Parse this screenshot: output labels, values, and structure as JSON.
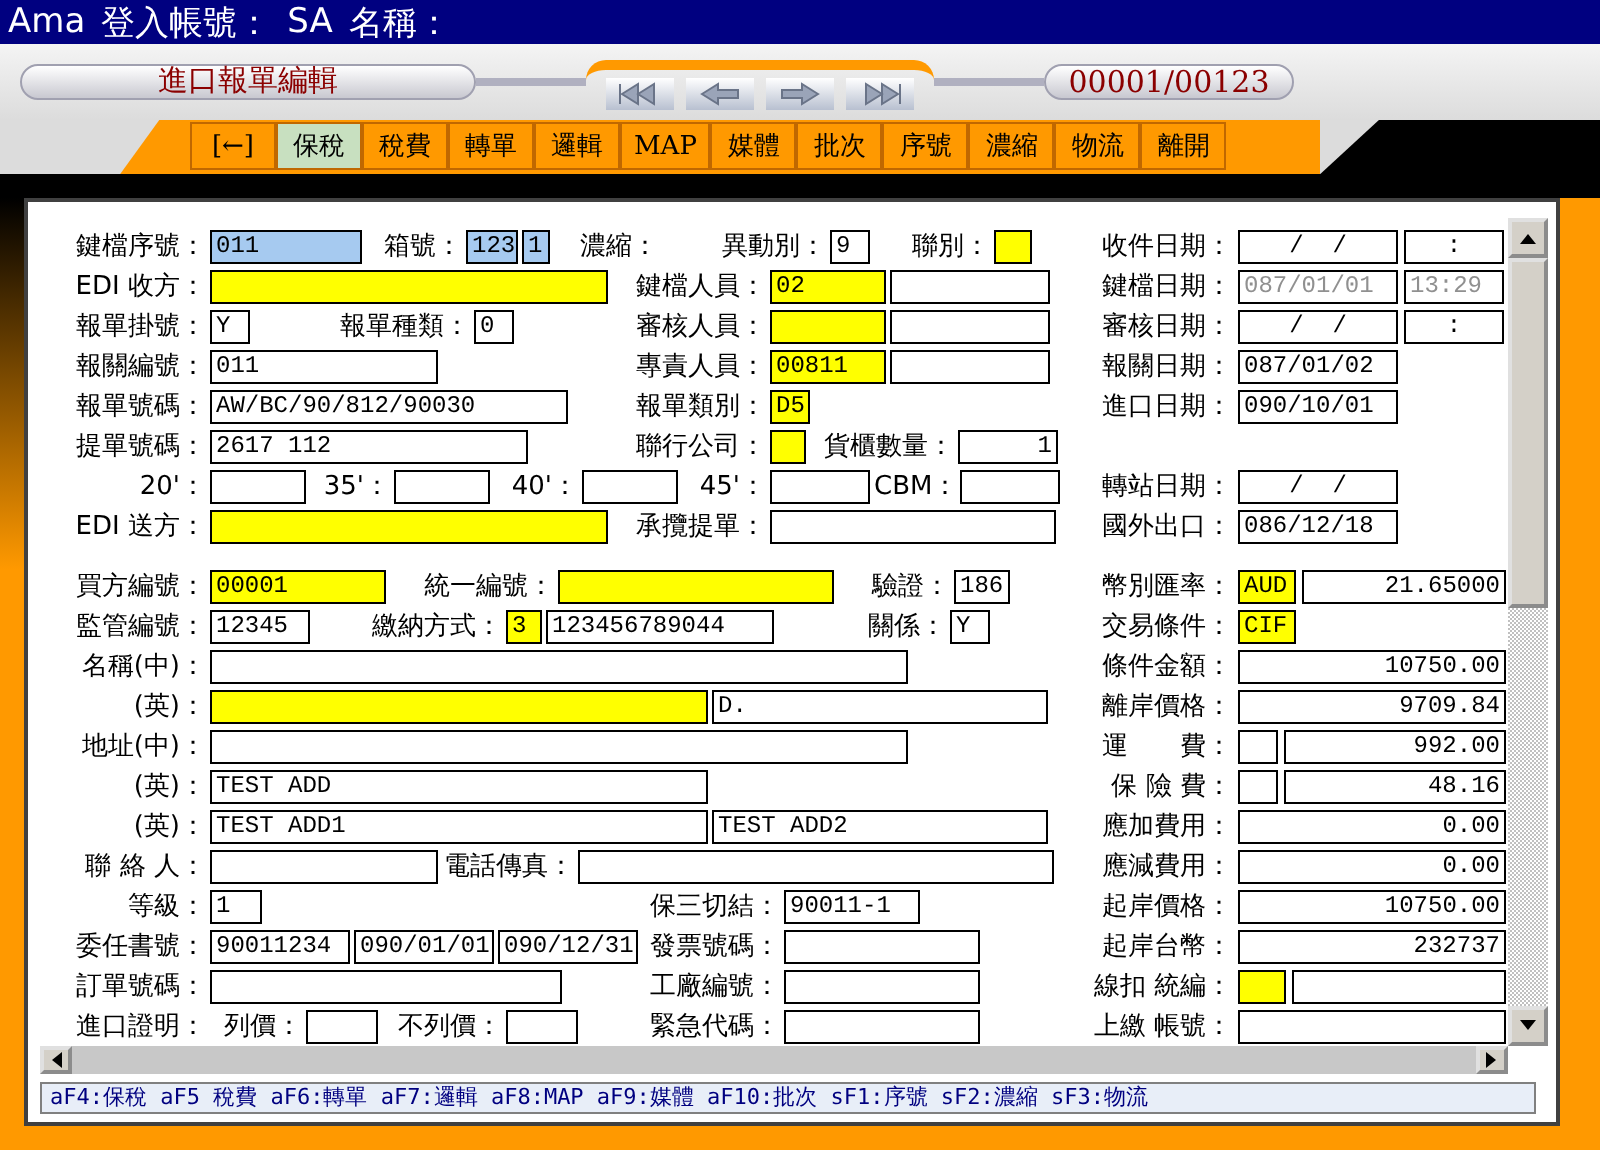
{
  "window": {
    "title": [
      "Ama",
      "登入帳號：",
      "SA",
      "名稱："
    ]
  },
  "header": {
    "screen_title": "進口報單編輯",
    "record_counter": "00001/00123"
  },
  "toolbar": [
    {
      "label": "[←]",
      "selected": false
    },
    {
      "label": "保稅",
      "selected": true
    },
    {
      "label": "稅費",
      "selected": false
    },
    {
      "label": "轉單",
      "selected": false
    },
    {
      "label": "邏輯",
      "selected": false
    },
    {
      "label": "MAP",
      "selected": false
    },
    {
      "label": "媒體",
      "selected": false
    },
    {
      "label": "批次",
      "selected": false
    },
    {
      "label": "序號",
      "selected": false
    },
    {
      "label": "濃縮",
      "selected": false
    },
    {
      "label": "物流",
      "selected": false
    },
    {
      "label": "離開",
      "selected": false
    }
  ],
  "sections": [
    {
      "rows": [
        {
          "left": [
            {
              "kind": "label",
              "text": "鍵檔序號："
            },
            {
              "kind": "field",
              "value": "011",
              "color": "#a6caf0"
            },
            {
              "kind": "label",
              "text": "箱號："
            },
            {
              "kind": "field",
              "value": "123",
              "color": "#a6caf0"
            },
            {
              "kind": "field",
              "value": "1",
              "color": "#a6caf0"
            },
            {
              "kind": "label",
              "text": "濃縮："
            },
            {
              "kind": "label",
              "text": "異動別："
            },
            {
              "kind": "field",
              "value": "9"
            },
            {
              "kind": "label",
              "text": "聯別："
            },
            {
              "kind": "field",
              "color": "#ffff00"
            }
          ],
          "right": [
            {
              "kind": "label",
              "text": "收件日期："
            },
            {
              "kind": "field",
              "value": "/  /",
              "center": true
            },
            {
              "kind": "field",
              "value": ":",
              "center": true
            }
          ]
        },
        {
          "left": [
            {
              "kind": "label",
              "text": "EDI 收方："
            },
            {
              "kind": "field",
              "color": "#ffff00"
            },
            {
              "kind": "label",
              "text": "鍵檔人員："
            },
            {
              "kind": "field",
              "value": "02",
              "color": "#ffff00"
            },
            {
              "kind": "field"
            }
          ],
          "right": [
            {
              "kind": "label",
              "text": "鍵檔日期："
            },
            {
              "kind": "field",
              "value": "087/01/01",
              "disabled": true
            },
            {
              "kind": "field",
              "value": "13:29",
              "disabled": true
            }
          ]
        },
        {
          "left": [
            {
              "kind": "label",
              "text": "報單掛號："
            },
            {
              "kind": "field",
              "value": "Y"
            },
            {
              "kind": "label",
              "text": "報單種類："
            },
            {
              "kind": "field",
              "value": "0"
            },
            {
              "kind": "label",
              "text": "審核人員："
            },
            {
              "kind": "field",
              "color": "#ffff00"
            },
            {
              "kind": "field"
            }
          ],
          "right": [
            {
              "kind": "label",
              "text": "審核日期："
            },
            {
              "kind": "field",
              "value": "/  /",
              "center": true
            },
            {
              "kind": "field",
              "value": ":",
              "center": true
            }
          ]
        },
        {
          "left": [
            {
              "kind": "label",
              "text": "報關編號："
            },
            {
              "kind": "field",
              "value": "011"
            },
            {
              "kind": "label",
              "text": "專責人員："
            },
            {
              "kind": "field",
              "value": "00811",
              "color": "#ffff00"
            },
            {
              "kind": "field"
            }
          ],
          "right": [
            {
              "kind": "label",
              "text": "報關日期："
            },
            {
              "kind": "field",
              "value": "087/01/02"
            }
          ]
        },
        {
          "left": [
            {
              "kind": "label",
              "text": "報單號碼："
            },
            {
              "kind": "field",
              "value": "AW/BC/90/812/90030"
            },
            {
              "kind": "label",
              "text": "報單類別："
            },
            {
              "kind": "field",
              "value": "D5",
              "color": "#ffff00"
            }
          ],
          "right": [
            {
              "kind": "label",
              "text": "進口日期："
            },
            {
              "kind": "field",
              "value": "090/10/01"
            }
          ]
        },
        {
          "left": [
            {
              "kind": "label",
              "text": "提單號碼："
            },
            {
              "kind": "field",
              "value": "2617 112"
            },
            {
              "kind": "label",
              "text": "聯行公司："
            },
            {
              "kind": "field",
              "color": "#ffff00"
            },
            {
              "kind": "label",
              "text": "貨櫃數量："
            },
            {
              "kind": "field",
              "value": "1",
              "numeric": true
            }
          ],
          "right": []
        },
        {
          "left": [
            {
              "kind": "label",
              "text": "20'："
            },
            {
              "kind": "field"
            },
            {
              "kind": "label",
              "text": "35'："
            },
            {
              "kind": "field"
            },
            {
              "kind": "label",
              "text": "40'："
            },
            {
              "kind": "field"
            },
            {
              "kind": "label",
              "text": "45'："
            },
            {
              "kind": "field"
            },
            {
              "kind": "label",
              "text": "CBM："
            },
            {
              "kind": "field"
            }
          ],
          "right": [
            {
              "kind": "label",
              "text": "轉站日期："
            },
            {
              "kind": "field",
              "value": "/  /",
              "center": true
            }
          ]
        },
        {
          "left": [
            {
              "kind": "label",
              "text": "EDI 送方："
            },
            {
              "kind": "field",
              "color": "#ffff00"
            },
            {
              "kind": "label",
              "text": "承攬提單："
            },
            {
              "kind": "field"
            }
          ],
          "right": [
            {
              "kind": "label",
              "text": "國外出口："
            },
            {
              "kind": "field",
              "value": "086/12/18"
            }
          ]
        }
      ]
    },
    {
      "rows": [
        {
          "left": [
            {
              "kind": "label",
              "text": "買方編號："
            },
            {
              "kind": "field",
              "value": "00001",
              "color": "#ffff00"
            },
            {
              "kind": "label",
              "text": "統一編號："
            },
            {
              "kind": "field",
              "color": "#ffff00"
            },
            {
              "kind": "label",
              "text": "驗證："
            },
            {
              "kind": "field",
              "value": "186"
            }
          ],
          "right": [
            {
              "kind": "label",
              "text": "幣別匯率："
            },
            {
              "kind": "field",
              "value": "AUD",
              "color": "#ffff00"
            },
            {
              "kind": "field",
              "value": "21.65000",
              "numeric": true
            }
          ]
        },
        {
          "left": [
            {
              "kind": "label",
              "text": "監管編號："
            },
            {
              "kind": "field",
              "value": "12345"
            },
            {
              "kind": "label",
              "text": "繳納方式："
            },
            {
              "kind": "field",
              "value": "3",
              "color": "#ffff00"
            },
            {
              "kind": "field",
              "value": "123456789044"
            },
            {
              "kind": "label",
              "text": "關係："
            },
            {
              "kind": "field",
              "value": "Y"
            }
          ],
          "right": [
            {
              "kind": "label",
              "text": "交易條件："
            },
            {
              "kind": "field",
              "value": "CIF",
              "color": "#ffff00"
            }
          ]
        },
        {
          "left": [
            {
              "kind": "label",
              "text": "名稱(中)："
            },
            {
              "kind": "field"
            }
          ],
          "right": [
            {
              "kind": "label",
              "text": "條件金額："
            },
            {
              "kind": "field",
              "value": "10750.00",
              "numeric": true
            }
          ]
        },
        {
          "left": [
            {
              "kind": "label",
              "text": "(英)："
            },
            {
              "kind": "field",
              "color": "#ffff00"
            },
            {
              "kind": "field",
              "value": "D."
            }
          ],
          "right": [
            {
              "kind": "label",
              "text": "離岸價格："
            },
            {
              "kind": "field",
              "value": "9709.84",
              "numeric": true
            }
          ]
        },
        {
          "left": [
            {
              "kind": "label",
              "text": "地址(中)："
            },
            {
              "kind": "field"
            }
          ],
          "right": [
            {
              "kind": "label",
              "text": "運　　費："
            },
            {
              "kind": "field"
            },
            {
              "kind": "field",
              "value": "992.00",
              "numeric": true
            }
          ]
        },
        {
          "left": [
            {
              "kind": "label",
              "text": "(英)："
            },
            {
              "kind": "field",
              "value": "TEST ADD"
            }
          ],
          "right": [
            {
              "kind": "label",
              "text": "保 險 費："
            },
            {
              "kind": "field"
            },
            {
              "kind": "field",
              "value": "48.16",
              "numeric": true
            }
          ]
        },
        {
          "left": [
            {
              "kind": "label",
              "text": "(英)："
            },
            {
              "kind": "field",
              "value": "TEST ADD1"
            },
            {
              "kind": "field",
              "value": "TEST ADD2"
            }
          ],
          "right": [
            {
              "kind": "label",
              "text": "應加費用："
            },
            {
              "kind": "field",
              "value": "0.00",
              "numeric": true
            }
          ]
        },
        {
          "left": [
            {
              "kind": "label",
              "text": "聯 絡 人："
            },
            {
              "kind": "field"
            },
            {
              "kind": "label",
              "text": "電話傳真："
            },
            {
              "kind": "field"
            }
          ],
          "right": [
            {
              "kind": "label",
              "text": "應減費用："
            },
            {
              "kind": "field",
              "value": "0.00",
              "numeric": true
            }
          ]
        },
        {
          "left": [
            {
              "kind": "label",
              "text": "等級："
            },
            {
              "kind": "field",
              "value": "1"
            },
            {
              "kind": "label",
              "text": "保三切結："
            },
            {
              "kind": "field",
              "value": "90011-1"
            }
          ],
          "right": [
            {
              "kind": "label",
              "text": "起岸價格："
            },
            {
              "kind": "field",
              "value": "10750.00",
              "numeric": true
            }
          ]
        },
        {
          "left": [
            {
              "kind": "label",
              "text": "委任書號："
            },
            {
              "kind": "field",
              "value": "90011234"
            },
            {
              "kind": "field",
              "value": "090/01/01"
            },
            {
              "kind": "field",
              "value": "090/12/31"
            },
            {
              "kind": "label",
              "text": "發票號碼："
            },
            {
              "kind": "field"
            }
          ],
          "right": [
            {
              "kind": "label",
              "text": "起岸台幣："
            },
            {
              "kind": "field",
              "value": "232737",
              "numeric": true
            }
          ]
        },
        {
          "left": [
            {
              "kind": "label",
              "text": "訂單號碼："
            },
            {
              "kind": "field"
            },
            {
              "kind": "label",
              "text": "工廠編號："
            },
            {
              "kind": "field"
            }
          ],
          "right": [
            {
              "kind": "label",
              "text": "線扣 統編："
            },
            {
              "kind": "field",
              "color": "#ffff00"
            },
            {
              "kind": "field"
            }
          ]
        },
        {
          "left": [
            {
              "kind": "label",
              "text": "進口證明："
            },
            {
              "kind": "label",
              "text": "列價："
            },
            {
              "kind": "field"
            },
            {
              "kind": "label",
              "text": "不列價："
            },
            {
              "kind": "field"
            },
            {
              "kind": "label",
              "text": "緊急代碼："
            },
            {
              "kind": "field"
            }
          ],
          "right": [
            {
              "kind": "label",
              "text": "上繳 帳號："
            },
            {
              "kind": "field"
            }
          ]
        }
      ]
    }
  ],
  "status_bar": "aF4:保稅 aF5 稅費 aF6:轉單 aF7:邏輯 aF8:MAP aF9:媒體 aF10:批次 sF1:序號 sF2:濃縮 sF3:物流"
}
